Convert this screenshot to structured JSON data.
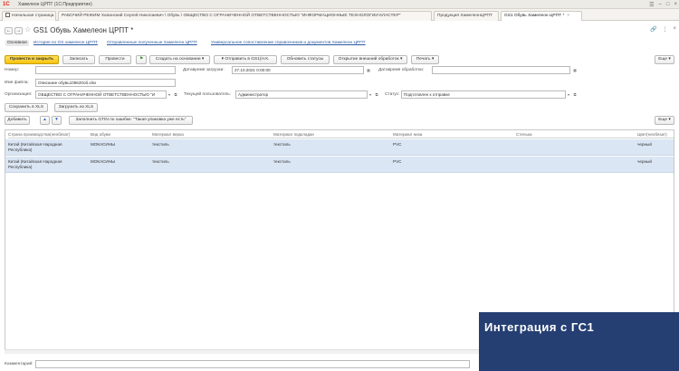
{
  "window": {
    "app_title": "Хамелеон ЦРПТ  (1С:Предприятие)",
    "logo_text": "1С"
  },
  "tabs": [
    {
      "label": "Начальная страница"
    },
    {
      "label": "РАБОЧИЙ РЕЖИМ Хапинский Сергей Николаевич \\ Обувь \\ ОБЩЕСТВО С ОГРАНИЧЕННОЙ ОТВЕТСТВЕННОСТЬЮ \"ИНФОРМАЦИОННЫЕ ТЕХНОЛОГИИ КЛАСТЕР\""
    },
    {
      "label": "Продукция ХамелеонЦРПТ"
    },
    {
      "label": "GS1 Обувь Хамелеон ЦРПТ *"
    }
  ],
  "document": {
    "title": "GS1 Обувь Хамелеон ЦРПТ *"
  },
  "panel_links": [
    {
      "label": "Основное"
    },
    {
      "label": "История по GS хамелеон ЦРПТ"
    },
    {
      "label": "Отправленные полученные Хамелеон ЦРПТ"
    },
    {
      "label": "Универсальное сопоставление справочников и документов Хамелеон ЦРПТ"
    }
  ],
  "toolbar": {
    "post_close": "Провести и закрыть",
    "save": "Записать",
    "post": "Провести",
    "create_based": "Создать на основании",
    "send_gs1": "Отправить в GS1(Н.К.",
    "update_status": "Обновить статусы",
    "open_ext": "Открытие внешний обработок",
    "print": "Печать",
    "more": "Еще"
  },
  "form": {
    "number_label": "Номер:",
    "number_value": "",
    "load_date_label": "Датавремя загрузки:",
    "load_date_value": "27.10.2021  0:00:00",
    "proc_date_label": "Датавремя обработки:",
    "proc_date_value": "",
    "filename_label": "Имя файла:",
    "filename_value": "Описание обувь108620об.xlsx",
    "org_label": "Организация:",
    "org_value": "ОБЩЕСТВО С ОГРАНИЧЕННОЙ ОТВЕТСТВЕННОСТЬЮ \"И",
    "user_label": "Текущий пользователь:",
    "user_value": "Администратор",
    "status_label": "Статус:",
    "status_value": "Подготовлен к отправке"
  },
  "xls": {
    "save": "Сохранить в XLS",
    "load": "Загрузить из XLS"
  },
  "table_toolbar": {
    "add": "Добавить",
    "fill_errors": "Заполнить GTIN по ошибке: \"Такая упаковка уже есть\"",
    "more": "Еще"
  },
  "table": {
    "columns": [
      "Страна производства(необязат)",
      "Вид обуви",
      "Материал верха",
      "Материал подкладки",
      "Материал низа",
      "Стелька",
      "Цвет(необязат)"
    ],
    "rows": [
      {
        "country_l1": "Китай (Китайская Народная",
        "country_l2": "Республика)",
        "type": "МОКАСИНЫ",
        "top": "текстиль",
        "lining": "текстиль",
        "bottom": "PVC",
        "insole": "",
        "color": "черный"
      },
      {
        "country_l1": "Китай (Китайская Народная",
        "country_l2": "Республика)",
        "type": "МОКАСИНЫ",
        "top": "текстиль",
        "lining": "текстиль",
        "bottom": "PVC",
        "insole": "",
        "color": "черный"
      }
    ]
  },
  "comment": {
    "label": "Комментарий:",
    "value": ""
  },
  "banner": {
    "text": "Интеграция с ГС1"
  }
}
